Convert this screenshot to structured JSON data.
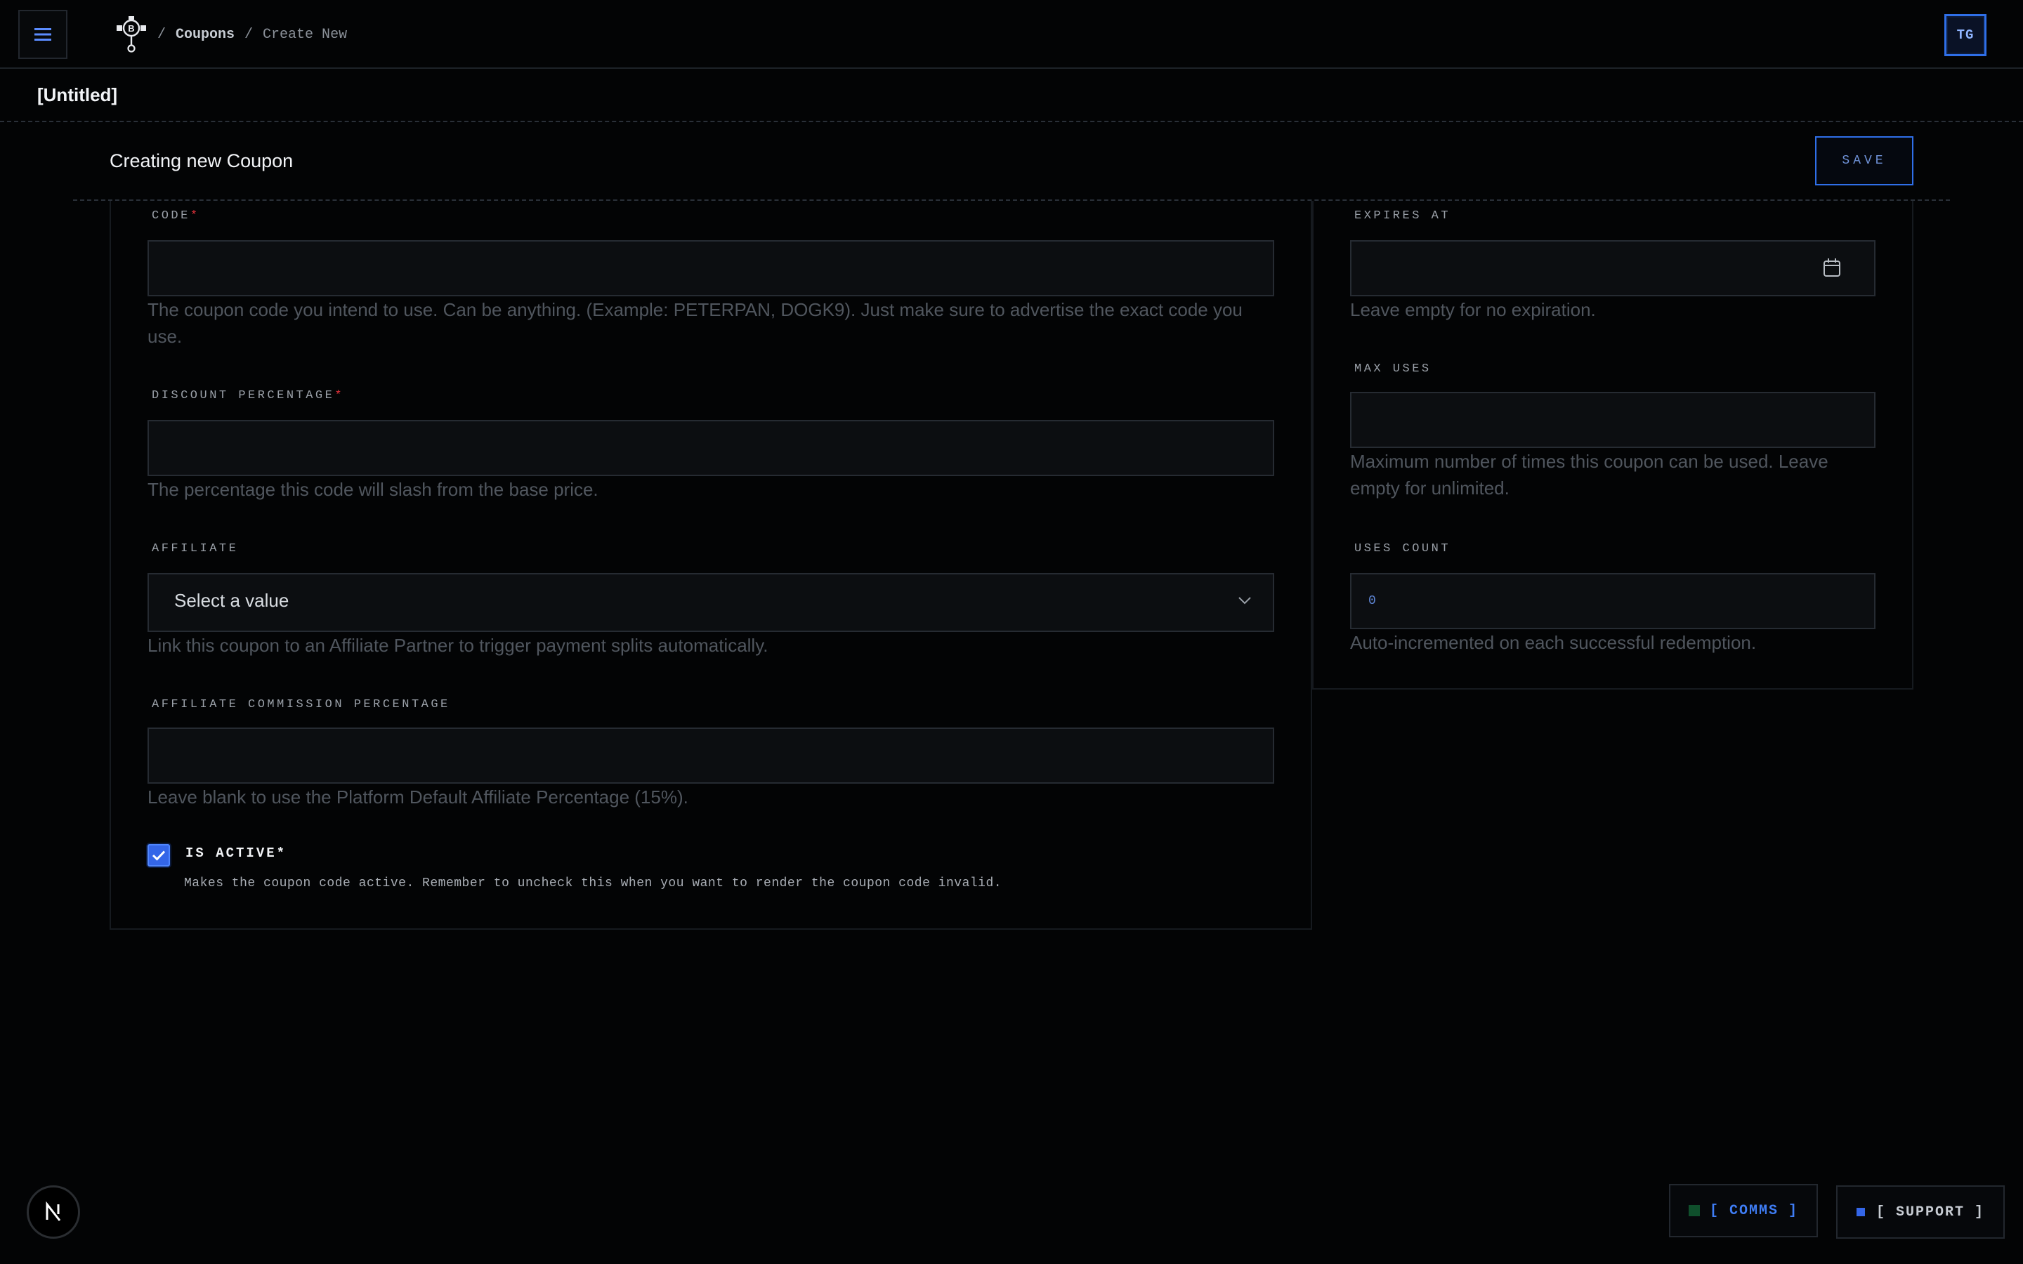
{
  "topbar": {
    "breadcrumb": {
      "separator_1": "/",
      "parent": "Coupons",
      "separator_2": "/",
      "current": "Create New"
    },
    "avatar_initials": "TG",
    "menu_icon": "hamburger-icon",
    "logo_icon": "brand-logo-icon"
  },
  "document": {
    "title": "[Untitled]"
  },
  "header": {
    "heading": "Creating new Coupon",
    "save_label": "SAVE"
  },
  "form": {
    "code": {
      "label": "CODE",
      "required_mark": "*",
      "value": "",
      "help": "The coupon code you intend to use. Can be anything. (Example: PETERPAN, DOGK9). Just make sure to advertise the exact code you use."
    },
    "discount_percentage": {
      "label": "DISCOUNT PERCENTAGE",
      "required_mark": "*",
      "value": "",
      "help": "The percentage this code will slash from the base price."
    },
    "affiliate": {
      "label": "AFFILIATE",
      "selected": "Select a value",
      "help": "Link this coupon to an Affiliate Partner to trigger payment splits automatically."
    },
    "affiliate_commission": {
      "label": "AFFILIATE COMMISSION PERCENTAGE",
      "value": "",
      "help": "Leave blank to use the Platform Default Affiliate Percentage (15%)."
    },
    "is_active": {
      "label": "IS ACTIVE*",
      "checked": true,
      "help": "Makes the coupon code active. Remember to uncheck this when you want to render the coupon code invalid."
    },
    "expires_at": {
      "label": "EXPIRES AT",
      "value": "",
      "help": "Leave empty for no expiration."
    },
    "max_uses": {
      "label": "MAX USES",
      "value": "",
      "help": "Maximum number of times this coupon can be used. Leave empty for unlimited."
    },
    "uses_count": {
      "label": "USES COUNT",
      "value": "0",
      "help": "Auto-incremented on each successful redemption."
    }
  },
  "footer": {
    "dev_badge_letter": "N",
    "comms_label": "[ COMMS ]",
    "support_label": "[ SUPPORT ]"
  },
  "colors": {
    "background": "#030405",
    "accent": "#3466e8",
    "required": "#e0313a",
    "comms_indicator": "#0f4f2c"
  }
}
